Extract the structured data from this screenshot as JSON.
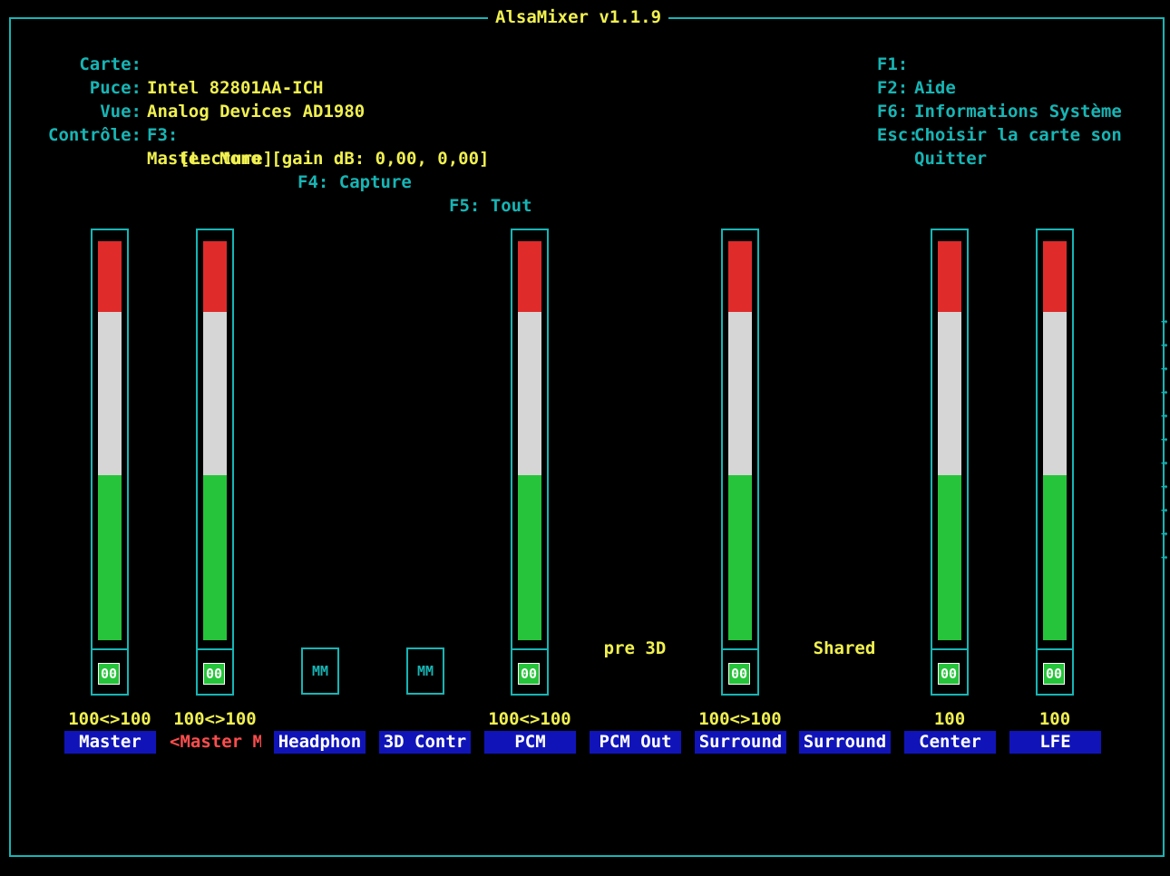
{
  "app": {
    "title": "AlsaMixer v1.1.9"
  },
  "info": {
    "card_label": "Carte:",
    "card_value": "Intel 82801AA-ICH",
    "chip_label": "Puce:",
    "chip_value": "Analog Devices AD1980",
    "view_label": "Vue:",
    "view_f3": "F3:",
    "view_playback": "[Lecture]",
    "view_f4": "F4: Capture",
    "view_f5": "F5: Tout",
    "control_label": "Contrôle:",
    "control_value": "Master Mono [gain dB: 0,00, 0,00]"
  },
  "keys": [
    {
      "key": "F1:",
      "action": "Aide"
    },
    {
      "key": "F2:",
      "action": "Informations Système"
    },
    {
      "key": "F6:",
      "action": "Choisir la carte son"
    },
    {
      "key": "Esc:",
      "action": "Quitter"
    }
  ],
  "channels": [
    {
      "name": "Master",
      "volume": "100<>100",
      "type": "slider",
      "mute": "00",
      "level_percent": 100
    },
    {
      "name": "<Master M>",
      "volume": "100<>100",
      "type": "slider",
      "mute": "00",
      "level_percent": 100,
      "selected": true
    },
    {
      "name": "Headphon",
      "type": "switch",
      "mute": "MM"
    },
    {
      "name": "3D Contr",
      "type": "switch",
      "mute": "MM"
    },
    {
      "name": "PCM",
      "volume": "100<>100",
      "type": "slider",
      "mute": "00",
      "level_percent": 100
    },
    {
      "name": "PCM Out",
      "type": "enum",
      "enum_value": "pre 3D"
    },
    {
      "name": "Surround",
      "volume": "100<>100",
      "type": "slider",
      "mute": "00",
      "level_percent": 100
    },
    {
      "name": "Surround",
      "type": "enum",
      "enum_value": "Shared"
    },
    {
      "name": "Center",
      "volume": "100",
      "type": "slider",
      "mute": "00",
      "level_percent": 100
    },
    {
      "name": "LFE",
      "volume": "100",
      "type": "slider",
      "mute": "00",
      "level_percent": 100
    }
  ],
  "colors": {
    "border": "#17b5b5",
    "text_yellow": "#f0f050",
    "name_bg": "#1014b8",
    "level_red": "#e02b2b",
    "level_white": "#d6d6d6",
    "level_green": "#26c43a",
    "selected_text": "#ff4d4d"
  },
  "scroll_indicator": "→"
}
